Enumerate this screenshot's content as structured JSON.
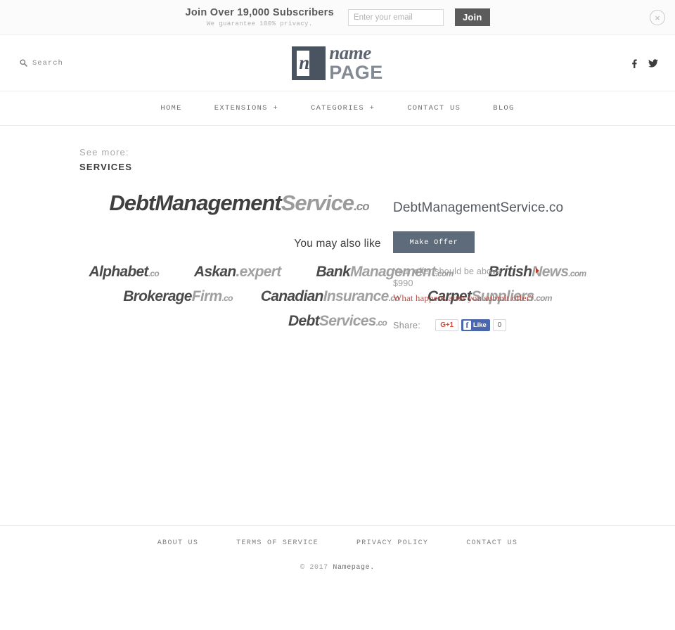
{
  "subscribe_bar": {
    "headline": "Join Over 19,000 Subscribers",
    "subline": "We guarantee 100% privacy.",
    "email_placeholder": "Enter your email",
    "email_value": "",
    "join_label": "Join",
    "close_icon": "×"
  },
  "header": {
    "search_label": "Search",
    "logo_mark_letter": "n",
    "logo_name": "name",
    "logo_page": "PAGE",
    "socials": [
      "facebook-icon",
      "twitter-icon"
    ]
  },
  "nav": {
    "items": [
      {
        "label": "HOME"
      },
      {
        "label": "EXTENSIONS +"
      },
      {
        "label": "CATEGORIES +"
      },
      {
        "label": "CONTACT US"
      },
      {
        "label": "BLOG"
      }
    ]
  },
  "see_more": {
    "label": "See more:",
    "category": "SERVICES"
  },
  "hero": {
    "part1": "DebtManagement",
    "part2": "Service",
    "tld": ".co"
  },
  "offer": {
    "domain_title": "DebtManagementService.co",
    "make_offer_label": "Make Offer",
    "note": "Your offer should be above",
    "price": "$990",
    "link": "What happens after you submit offer?",
    "share_label": "Share:",
    "gplus_label": "G+1",
    "fb_f": "f",
    "fb_like_label": "Like",
    "fb_count": "0"
  },
  "also_like": {
    "title": "You may also like",
    "rows": [
      [
        {
          "part1": "Alphabet",
          "part2": "",
          "tld": ".co"
        },
        {
          "part1": "Askan",
          "part2": "",
          "tld": ".expert"
        },
        {
          "part1": "Bank",
          "part2": "Management",
          "tld": ".com"
        },
        {
          "part1": "British",
          "part2": "News",
          "tld": ".com"
        }
      ],
      [
        {
          "part1": "Brokerage",
          "part2": "Firm",
          "tld": ".co"
        },
        {
          "part1": "Canadian",
          "part2": "Insurance",
          "tld": ".co"
        },
        {
          "part1": "Carpet",
          "part2": "Suppliers",
          "tld": ".com"
        }
      ],
      [
        {
          "part1": "Debt",
          "part2": "Services",
          "tld": ".co"
        }
      ]
    ]
  },
  "footer": {
    "links": [
      {
        "label": "ABOUT US"
      },
      {
        "label": "TERMS OF SERVICE"
      },
      {
        "label": "PRIVACY POLICY"
      },
      {
        "label": "CONTACT US"
      }
    ],
    "copyright_prefix": "© 2017 ",
    "copyright_name": "Namepage."
  },
  "colors": {
    "accent_button": "#5d6b7a",
    "link_red": "#b4524a",
    "arrow_red": "#c0392b",
    "facebook_blue": "#4a66ad",
    "gplus_red": "#d34836",
    "logo_dark": "#4a5360"
  }
}
